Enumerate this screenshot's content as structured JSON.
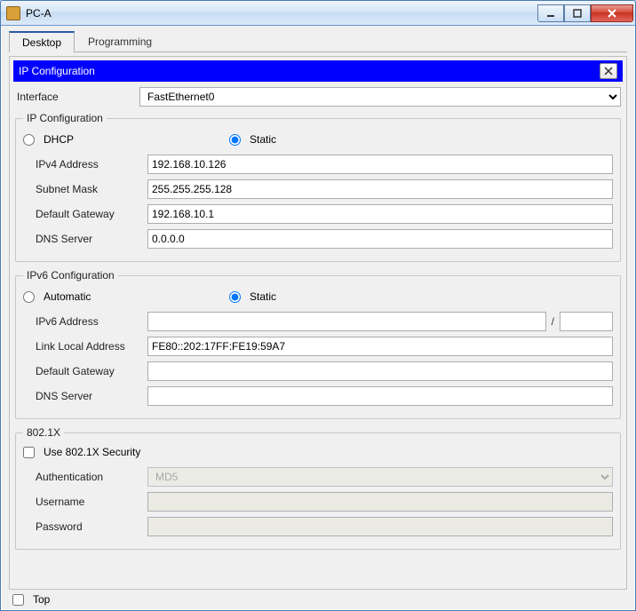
{
  "window": {
    "title": "PC-A"
  },
  "tabs": {
    "desktop": "Desktop",
    "programming": "Programming"
  },
  "panel": {
    "title": "IP Configuration"
  },
  "interface": {
    "label": "Interface",
    "value": "FastEthernet0"
  },
  "ipcfg": {
    "legend": "IP Configuration",
    "dhcp": "DHCP",
    "static": "Static",
    "ipv4_label": "IPv4 Address",
    "ipv4": "192.168.10.126",
    "mask_label": "Subnet Mask",
    "mask": "255.255.255.128",
    "gw_label": "Default Gateway",
    "gw": "192.168.10.1",
    "dns_label": "DNS Server",
    "dns": "0.0.0.0"
  },
  "ipv6": {
    "legend": "IPv6 Configuration",
    "auto": "Automatic",
    "static": "Static",
    "addr_label": "IPv6 Address",
    "addr": "",
    "slash": "/",
    "prefix": "",
    "ll_label": "Link Local Address",
    "ll": "FE80::202:17FF:FE19:59A7",
    "gw_label": "Default Gateway",
    "gw": "",
    "dns_label": "DNS Server",
    "dns": ""
  },
  "dot1x": {
    "legend": "802.1X",
    "use": "Use 802.1X Security",
    "auth_label": "Authentication",
    "auth": "MD5",
    "user_label": "Username",
    "user": "",
    "pass_label": "Password",
    "pass": ""
  },
  "bottom": {
    "top": "Top"
  }
}
